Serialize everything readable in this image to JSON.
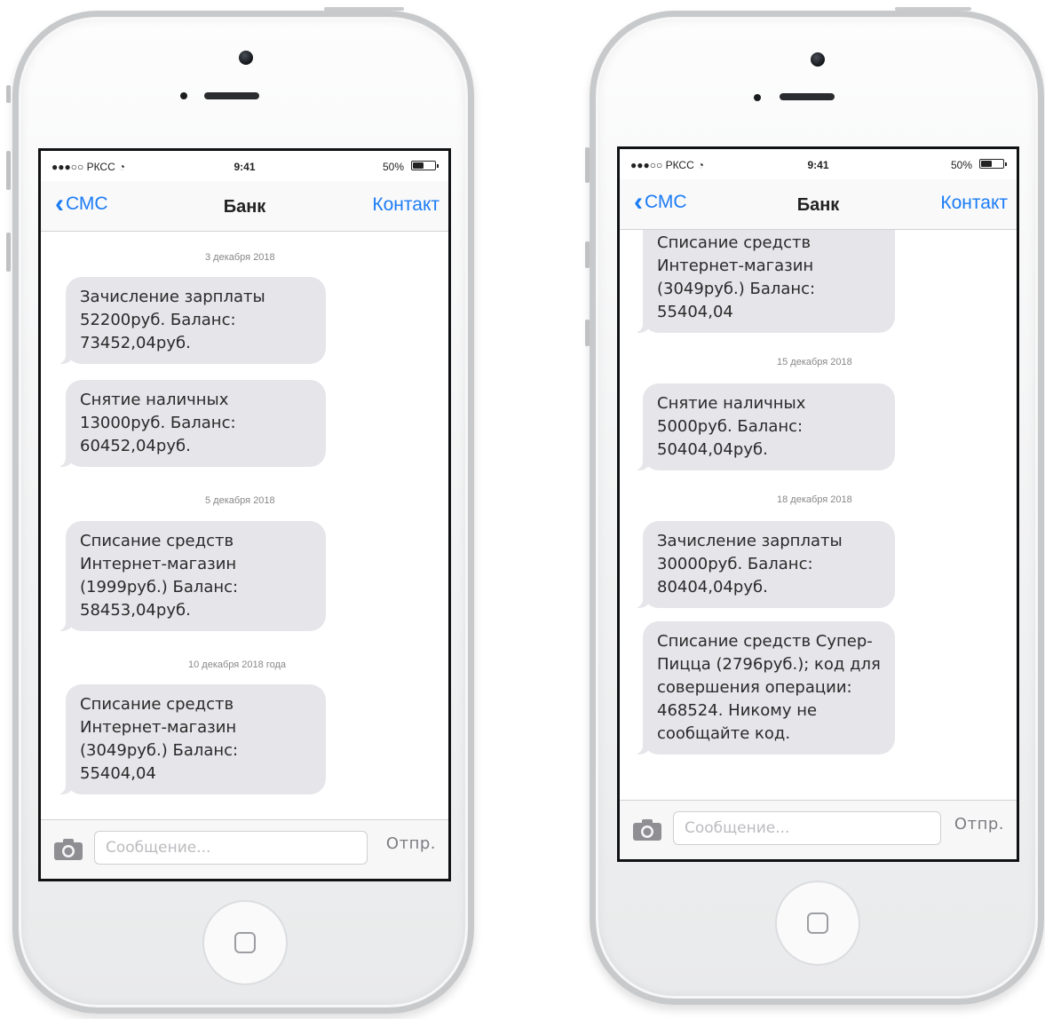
{
  "left_phone": {
    "status": {
      "carrier": "●●●○○ РКСС",
      "time": "9:41",
      "battery": "50%",
      "battery_level": 0.5
    },
    "nav": {
      "back": "СМС",
      "title": "Банк",
      "right": "Контакт"
    },
    "thread": [
      {
        "type": "date",
        "text": "3 декабря 2018"
      },
      {
        "type": "msg",
        "text": "Зачисление зарплаты 52200руб. Баланс: 73452,04руб."
      },
      {
        "type": "msg",
        "text": "Снятие наличных 13000руб. Баланс: 60452,04руб."
      },
      {
        "type": "date",
        "text": "5 декабря 2018"
      },
      {
        "type": "msg",
        "text": "Списание средств Интернет-магазин (1999руб.) Баланс: 58453,04руб."
      },
      {
        "type": "date",
        "text": "10 декабря 2018 года"
      },
      {
        "type": "msg",
        "text": "Списание средств Интернет-магазин (3049руб.) Баланс: 55404,04"
      }
    ],
    "input": {
      "placeholder": "Сообщение...",
      "send": "Отпр."
    }
  },
  "right_phone": {
    "status": {
      "carrier": "●●●○○ РКСС",
      "time": "9:41",
      "battery": "50%",
      "battery_level": 0.5
    },
    "nav": {
      "back": "СМС",
      "title": "Банк",
      "right": "Контакт"
    },
    "thread": [
      {
        "type": "msg",
        "text": "Списание средств Интернет-магазин (3049руб.) Баланс: 55404,04"
      },
      {
        "type": "date",
        "text": "15 декабря 2018"
      },
      {
        "type": "msg",
        "text": "Снятие наличных 5000руб. Баланс: 50404,04руб."
      },
      {
        "type": "date",
        "text": "18 декабря 2018"
      },
      {
        "type": "msg",
        "text": "Зачисление зарплаты 30000руб. Баланс: 80404,04руб."
      },
      {
        "type": "msg",
        "text": "Списание средств Супер-Пицца (2796руб.); код для совершения операции: 468524. Никому не сообщайте код."
      }
    ],
    "input": {
      "placeholder": "Сообщение...",
      "send": "Отпр."
    }
  }
}
